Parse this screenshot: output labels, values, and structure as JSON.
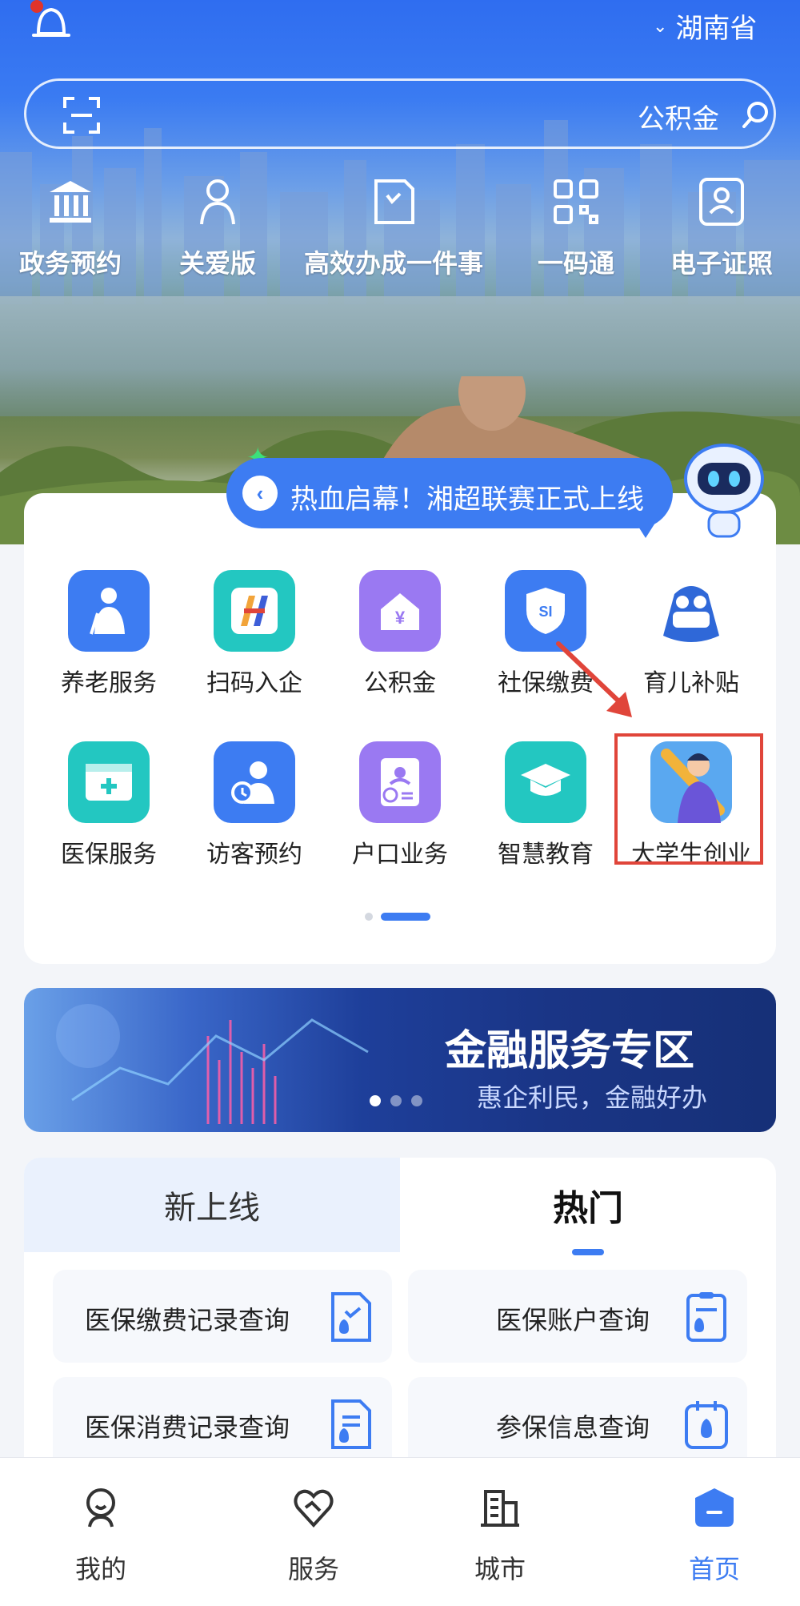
{
  "header": {
    "region": "湖南省",
    "search_query": "公积金"
  },
  "quick_actions": [
    {
      "label": "电子证照",
      "icon": "person-card-icon"
    },
    {
      "label": "一码通",
      "icon": "qr-code-icon"
    },
    {
      "label": "高效办成一件事",
      "icon": "clock-doc-icon"
    },
    {
      "label": "关爱版",
      "icon": "caregiver-icon"
    },
    {
      "label": "政务预约",
      "icon": "government-building-icon"
    }
  ],
  "announcement": {
    "text": "热血启幕！湘超联赛正式上线"
  },
  "services": [
    {
      "label": "育儿补贴",
      "icon": "childcare-bag-icon",
      "color": "#ffffff"
    },
    {
      "label": "社保缴费",
      "icon": "shield-icon",
      "color": "#3d7cf2"
    },
    {
      "label": "公积金",
      "icon": "house-yuan-icon",
      "color": "#9a79f2"
    },
    {
      "label": "扫码入企",
      "icon": "enterprise-icon",
      "color": "#23c7c1"
    },
    {
      "label": "养老服务",
      "icon": "elderly-icon",
      "color": "#3d7cf2"
    },
    {
      "label": "大学生创业",
      "icon": "graduate-startup-icon",
      "color": "#5aa8f0"
    },
    {
      "label": "智慧教育",
      "icon": "graduation-cap-icon",
      "color": "#23c7c1"
    },
    {
      "label": "户口业务",
      "icon": "household-icon",
      "color": "#9a79f2"
    },
    {
      "label": "访客预约",
      "icon": "visitor-icon",
      "color": "#3d7cf2"
    },
    {
      "label": "医保服务",
      "icon": "medical-card-icon",
      "color": "#23c7c1"
    }
  ],
  "finance_banner": {
    "title": "金融服务专区",
    "subtitle": "惠企利民，金融好办"
  },
  "tabs": {
    "active": "热门",
    "inactive": "新上线"
  },
  "hot_items": [
    {
      "label": "医保账户查询",
      "icon": "clipboard-drop-icon"
    },
    {
      "label": "医保缴费记录查询",
      "icon": "doc-drop-icon"
    },
    {
      "label": "参保信息查询",
      "icon": "calendar-drop-icon"
    },
    {
      "label": "医保消费记录查询",
      "icon": "list-drop-icon"
    }
  ],
  "bottom_nav": [
    {
      "label": "首页",
      "icon": "home-icon"
    },
    {
      "label": "城市",
      "icon": "city-icon"
    },
    {
      "label": "服务",
      "icon": "heart-hands-icon"
    },
    {
      "label": "我的",
      "icon": "profile-icon"
    }
  ],
  "colors": {
    "primary": "#3d7cf2",
    "highlight": "#e0453a"
  }
}
